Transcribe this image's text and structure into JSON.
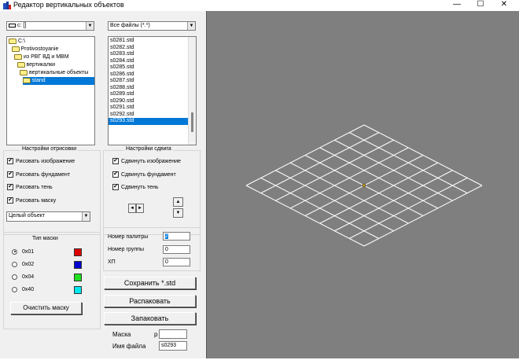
{
  "window": {
    "title": "Редактор вертикальных объектов",
    "minimize": "—",
    "maximize": "☐",
    "close": "✕"
  },
  "drive": {
    "value": "c: []"
  },
  "filter": {
    "value": "Все файлы (*.*)"
  },
  "folders": [
    {
      "label": "C:\\",
      "indent": 0,
      "selected": false
    },
    {
      "label": "Protivostoyanie",
      "indent": 1,
      "selected": false
    },
    {
      "label": "из РВГ ВД и МВМ",
      "indent": 2,
      "selected": false
    },
    {
      "label": "вертикалки",
      "indent": 3,
      "selected": false
    },
    {
      "label": "вертикальные объекты",
      "indent": 4,
      "selected": false
    },
    {
      "label": "stand",
      "indent": 5,
      "selected": true
    }
  ],
  "files": {
    "items": [
      "s0281.std",
      "s0282.std",
      "s0283.std",
      "s0284.std",
      "s0285.std",
      "s0286.std",
      "s0287.std",
      "s0288.std",
      "s0289.std",
      "s0290.std",
      "s0291.std",
      "s0292.std",
      "s0293.std"
    ],
    "selected": "s0293.std"
  },
  "render_settings": {
    "title": "Настройки отрисовки",
    "checkboxes": [
      {
        "label": "Рисовать изображение",
        "checked": true
      },
      {
        "label": "Рисовать фундамент",
        "checked": true
      },
      {
        "label": "Рисовать тень",
        "checked": true
      },
      {
        "label": "Рисовать маску",
        "checked": true
      }
    ],
    "object_mode": "Целый объект"
  },
  "shift_settings": {
    "title": "Настройки сдвига",
    "checkboxes": [
      {
        "label": "Сдвинуть изображение",
        "checked": true
      },
      {
        "label": "Сдвинуть фундамент",
        "checked": true
      },
      {
        "label": "Сдвинуть тень",
        "checked": true
      }
    ]
  },
  "mask_type": {
    "title": "Тип маски",
    "options": [
      {
        "label": "0x01",
        "color": "#e00000",
        "selected": true
      },
      {
        "label": "0x02",
        "color": "#0000d0",
        "selected": false
      },
      {
        "label": "0x04",
        "color": "#20e020",
        "selected": false
      },
      {
        "label": "0x40",
        "color": "#00e8f0",
        "selected": false
      }
    ],
    "clear_button": "Очистить маску"
  },
  "fields": {
    "palette_label": "Номер палитры",
    "palette_value": "2",
    "group_label": "Номер группы",
    "group_value": "0",
    "hp_label": "ХП",
    "hp_value": "0"
  },
  "actions": {
    "save": "Сохранить *.std",
    "unpack": "Распаковать",
    "pack": "Запаковать"
  },
  "bottom": {
    "mask_label": "Маска",
    "mask_value": "р",
    "filename_label": "Имя файла",
    "filename_value": "s0293"
  },
  "icons": {
    "checkmark": "✔",
    "arrow_left": "◄",
    "arrow_right": "►",
    "arrow_up": "▲",
    "arrow_down": "▼",
    "combo_arrow": "▼"
  },
  "viewport": {
    "background": "#7f7f7f",
    "grid_color": "#ffffff",
    "grid_cells": 8
  }
}
